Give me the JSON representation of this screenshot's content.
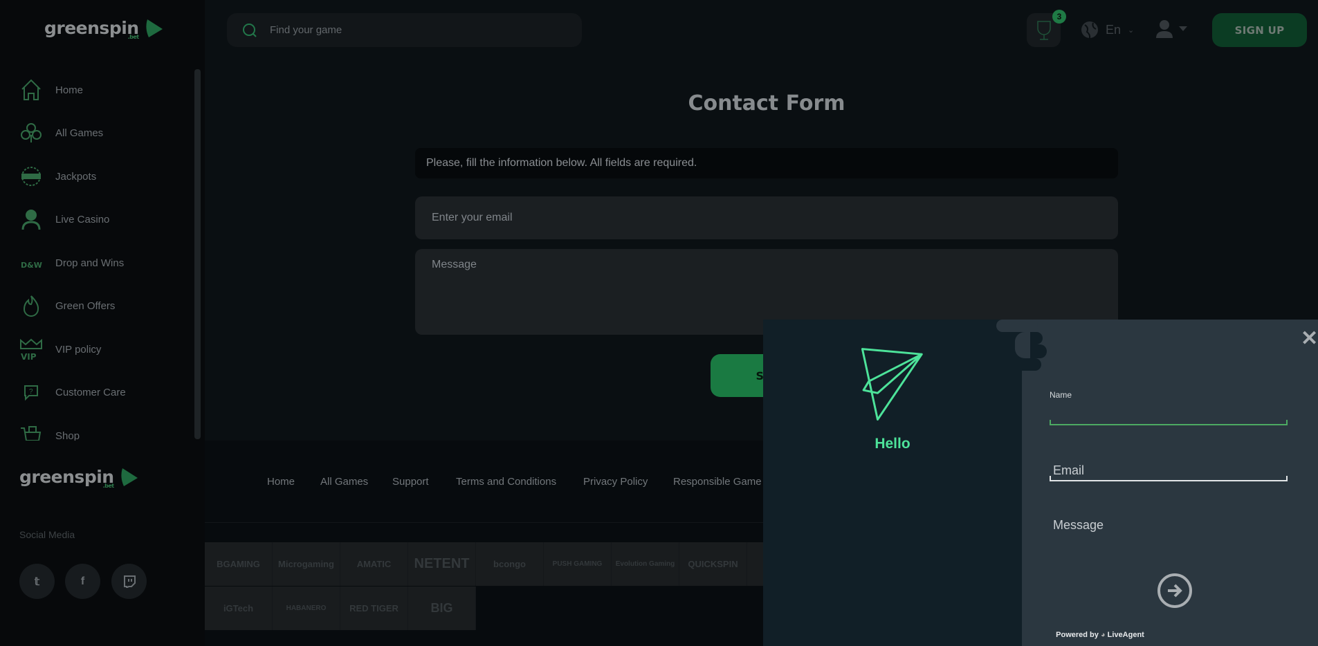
{
  "brand": {
    "name": "greenspin",
    "tld": ".bet"
  },
  "search": {
    "placeholder": "Find your game"
  },
  "header": {
    "notifications": "3",
    "language": "En",
    "signup": "SIGN UP"
  },
  "sidebar": {
    "items": [
      {
        "label": "Home",
        "icon": "home-icon"
      },
      {
        "label": "All Games",
        "icon": "club-icon"
      },
      {
        "label": "Jackpots",
        "icon": "jackpot-icon"
      },
      {
        "label": "Live Casino",
        "icon": "dealer-icon"
      },
      {
        "label": "Drop and Wins",
        "icon": "drop-wins-icon"
      },
      {
        "label": "Green Offers",
        "icon": "flame-icon"
      },
      {
        "label": "VIP policy",
        "icon": "vip-crown-icon"
      },
      {
        "label": "Customer Care",
        "icon": "help-chat-icon"
      },
      {
        "label": "Shop",
        "icon": "cart-icon"
      }
    ],
    "social_title": "Social Media",
    "social": [
      "twitter",
      "facebook",
      "twitch"
    ]
  },
  "contact": {
    "title": "Contact Form",
    "info": "Please, fill the information below. All fields are required.",
    "email_placeholder": "Enter your email",
    "message_placeholder": "Message",
    "send": "SEND"
  },
  "footer": {
    "links": [
      "Home",
      "All Games",
      "Support",
      "Terms and Conditions",
      "Privacy Policy",
      "Responsible Game"
    ],
    "partners": [
      "BGAMING",
      "Microgaming",
      "AMATIC",
      "NETENT",
      "bcongo",
      "PUSH GAMING",
      "Evolution Gaming",
      "QUICKSPIN",
      "iGTech",
      "HABANERO",
      "RED TIGER",
      "BIG"
    ]
  },
  "popup": {
    "greeting": "Hello",
    "name_label": "Name",
    "email_label": "Email",
    "message_label": "Message",
    "powered_by": "Powered by",
    "provider": "LiveAgent",
    "accent": "#4de39a"
  }
}
